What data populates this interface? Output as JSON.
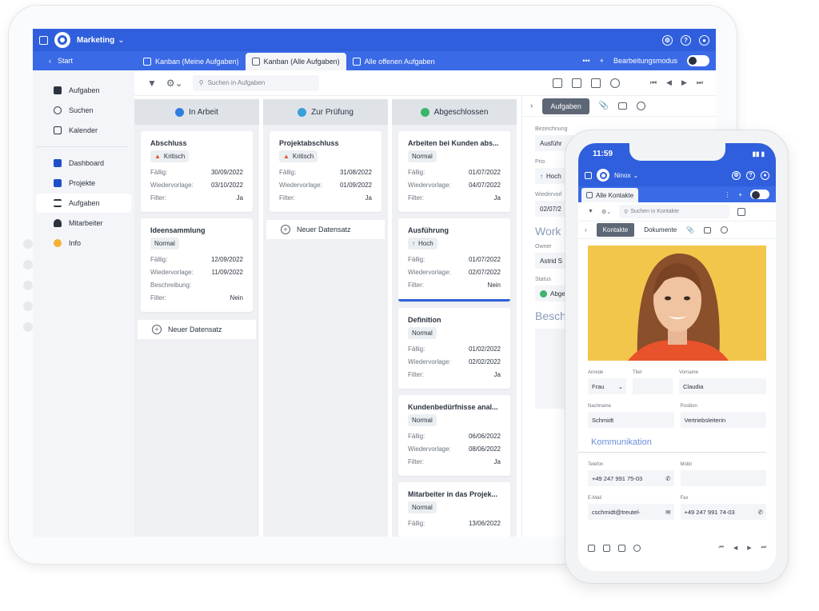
{
  "tablet": {
    "app_name": "Marketing",
    "start_label": "Start",
    "tabs": [
      {
        "label": "Kanban (Meine Aufgaben)"
      },
      {
        "label": "Kanban (Alle Aufgaben)"
      },
      {
        "label": "Alle offenen Aufgaben"
      }
    ],
    "edit_mode_label": "Bearbeitungsmodus",
    "sidebar": {
      "items": [
        {
          "label": "Aufgaben"
        },
        {
          "label": "Suchen"
        },
        {
          "label": "Kalender"
        },
        {
          "label": "Dashboard"
        },
        {
          "label": "Projekte"
        },
        {
          "label": "Aufgaben"
        },
        {
          "label": "Mitarbeiter"
        },
        {
          "label": "Info"
        }
      ]
    },
    "search_placeholder": "Suchen in Aufgaben",
    "columns": [
      {
        "title": "In Arbeit",
        "color": "#2f7de1",
        "cards": [
          {
            "title": "Abschluss",
            "badge": "Kritisch",
            "rows": [
              {
                "k": "Fällig:",
                "v": "30/09/2022"
              },
              {
                "k": "Wiedervorlage:",
                "v": "03/10/2022"
              },
              {
                "k": "Filter:",
                "v": "Ja"
              }
            ]
          },
          {
            "title": "Ideensammlung",
            "badge": "Normal",
            "rows": [
              {
                "k": "Fällig:",
                "v": "12/09/2022"
              },
              {
                "k": "Wiedervorlage:",
                "v": "11/09/2022"
              },
              {
                "k": "Beschreibung:",
                "v": ""
              },
              {
                "k": "Filter:",
                "v": "Nein"
              }
            ]
          }
        ],
        "new_label": "Neuer Datensatz"
      },
      {
        "title": "Zur Prüfung",
        "color": "#3aa0d8",
        "cards": [
          {
            "title": "Projektabschluss",
            "badge": "Kritisch",
            "rows": [
              {
                "k": "Fällig:",
                "v": "31/08/2022"
              },
              {
                "k": "Wiedervorlage:",
                "v": "01/09/2022"
              },
              {
                "k": "Filter:",
                "v": "Ja"
              }
            ]
          }
        ],
        "new_label": "Neuer Datensatz"
      },
      {
        "title": "Abgeschlossen",
        "color": "#3bb56a",
        "cards": [
          {
            "title": "Arbeiten bei Kunden abs...",
            "badge": "Normal",
            "rows": [
              {
                "k": "Fällig:",
                "v": "01/07/2022"
              },
              {
                "k": "Wiedervorlage:",
                "v": "04/07/2022"
              },
              {
                "k": "Filter:",
                "v": "Ja"
              }
            ]
          },
          {
            "title": "Ausführung",
            "badge": "Hoch",
            "rows": [
              {
                "k": "Fällig:",
                "v": "01/07/2022"
              },
              {
                "k": "Wiedervorlage:",
                "v": "02/07/2022"
              },
              {
                "k": "Filter:",
                "v": "Nein"
              }
            ]
          },
          {
            "title": "Definition",
            "badge": "Normal",
            "rows": [
              {
                "k": "Fällig:",
                "v": "01/02/2022"
              },
              {
                "k": "Wiedervorlage:",
                "v": "02/02/2022"
              },
              {
                "k": "Filter:",
                "v": "Ja"
              }
            ]
          },
          {
            "title": "Kundenbedürfnisse anal...",
            "badge": "Normal",
            "rows": [
              {
                "k": "Fällig:",
                "v": "06/06/2022"
              },
              {
                "k": "Wiedervorlage:",
                "v": "08/06/2022"
              },
              {
                "k": "Filter:",
                "v": "Ja"
              }
            ]
          },
          {
            "title": "Mitarbeiter in das Projek...",
            "badge": "Normal",
            "rows": [
              {
                "k": "Fällig:",
                "v": "13/06/2022"
              }
            ]
          }
        ]
      }
    ],
    "detail": {
      "tab_label": "Aufgaben",
      "bezeichnung_label": "Bezeichnung",
      "bezeichnung_value": "Ausführ",
      "prio_label": "Prio",
      "prio_value": "Hoch",
      "wiedervorlage_label": "Wiedervorl",
      "wiedervorlage_value": "02/07/2",
      "section1": "Work",
      "owner_label": "Owner",
      "owner_value": "Astrid S",
      "status_label": "Status",
      "status_value": "Abge",
      "section2": "Besch"
    }
  },
  "phone": {
    "time": "11:59",
    "app_name": "Ninox",
    "tab_label": "Alle Kontakte",
    "search_placeholder": "Suchen in Kontakte",
    "tabs": [
      {
        "label": "Kontakte"
      },
      {
        "label": "Dokumente"
      }
    ],
    "fields": {
      "anrede_label": "Anrede",
      "anrede_value": "Frau",
      "titel_label": "Titel",
      "titel_value": "",
      "vorname_label": "Vorname",
      "vorname_value": "Claudia",
      "nachname_label": "Nachname",
      "nachname_value": "Schmidt",
      "position_label": "Position",
      "position_value": "Vertriebsleiterin"
    },
    "section": "Kommunikation",
    "comm": {
      "telefon_label": "Telefon",
      "telefon_value": "+49 247 991 75-03",
      "mobil_label": "Mobil",
      "mobil_value": "",
      "email_label": "E-Mail",
      "email_value": "cschmidt@treutel-",
      "fax_label": "Fax",
      "fax_value": "+49 247 991 74-03"
    }
  }
}
